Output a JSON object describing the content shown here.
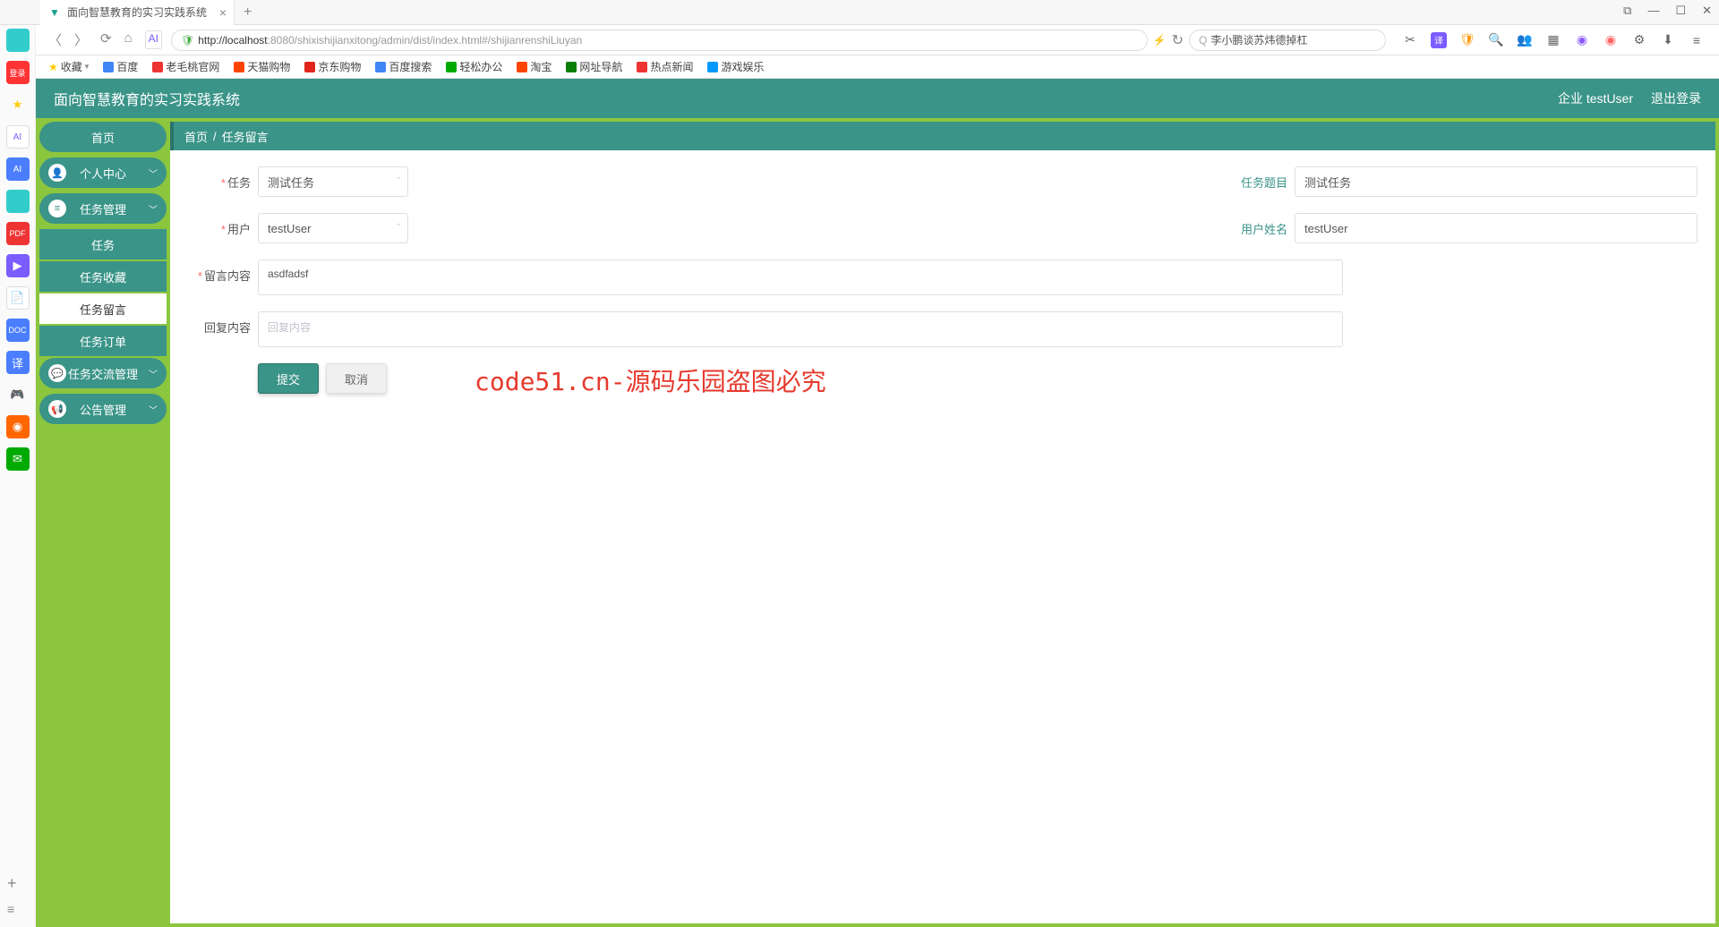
{
  "browser": {
    "tab_title": "面向智慧教育的实习实践系统",
    "url_host": "http://localhost",
    "url_path": ":8080/shixishijianxitong/admin/dist/index.html#/shijianrenshiLiuyan",
    "search_placeholder": "李小鹏谈苏炜德掉杠"
  },
  "bookmarks": {
    "fav": "收藏",
    "items": [
      "百度",
      "老毛桃官网",
      "天猫购物",
      "京东购物",
      "百度搜索",
      "轻松办公",
      "淘宝",
      "网址导航",
      "热点新闻",
      "游戏娱乐"
    ]
  },
  "header": {
    "title": "面向智慧教育的实习实践系统",
    "user_label": "企业 testUser",
    "logout": "退出登录"
  },
  "sidebar": {
    "home": "首页",
    "personal": "个人中心",
    "task_mgmt": "任务管理",
    "task": "任务",
    "task_fav": "任务收藏",
    "task_msg": "任务留言",
    "task_order": "任务订单",
    "comm_mgmt": "任务交流管理",
    "notice_mgmt": "公告管理"
  },
  "breadcrumb": {
    "home": "首页",
    "sep": "/",
    "current": "任务留言"
  },
  "form": {
    "task_label": "任务",
    "task_value": "测试任务",
    "task_title_label": "任务题目",
    "task_title_value": "测试任务",
    "user_label": "用户",
    "user_value": "testUser",
    "user_name_label": "用户姓名",
    "user_name_value": "testUser",
    "msg_label": "留言内容",
    "msg_value": "asdfadsf",
    "reply_label": "回复内容",
    "reply_placeholder": "回复内容",
    "submit": "提交",
    "cancel": "取消"
  },
  "watermark_red": "code51.cn-源码乐园盗图必究"
}
